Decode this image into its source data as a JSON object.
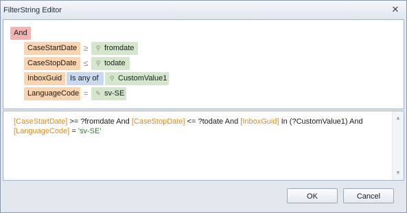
{
  "window": {
    "title": "FilterString Editor",
    "close_glyph": "✕"
  },
  "tree": {
    "group_operator": "And",
    "conditions": [
      {
        "field": "CaseStartDate",
        "operator": "≥",
        "value_icon": "parameter-icon",
        "value": "fromdate"
      },
      {
        "field": "CaseStopDate",
        "operator": "≤",
        "value_icon": "parameter-icon",
        "value": "todate"
      },
      {
        "field": "InboxGuid",
        "operator": "Is any of",
        "value_icon": "parameter-icon",
        "value": "CustomValue1"
      },
      {
        "field": "LanguageCode",
        "operator": "=",
        "value_icon": "pencil-icon",
        "value": "sv-SE"
      }
    ]
  },
  "filter_text": {
    "line1": [
      {
        "t": "[CaseStartDate]",
        "k": "field"
      },
      {
        "t": " >= ?fromdate And ",
        "k": "plain"
      },
      {
        "t": "[CaseStopDate]",
        "k": "field"
      },
      {
        "t": " <= ?todate And ",
        "k": "plain"
      },
      {
        "t": "[InboxGuid]",
        "k": "field"
      },
      {
        "t": " In (?CustomValue1) And",
        "k": "plain"
      }
    ],
    "line2": [
      {
        "t": "[LanguageCode]",
        "k": "field"
      },
      {
        "t": " = ",
        "k": "plain"
      },
      {
        "t": "'sv-SE'",
        "k": "value"
      }
    ]
  },
  "buttons": {
    "ok": "OK",
    "cancel": "Cancel"
  },
  "colors": {
    "group_chip": "#f4b4b2",
    "field_chip": "#fad4ae",
    "value_chip": "#d4e7cd",
    "operator_chip": "#c8d8ee",
    "field_text": "#d98a1c",
    "value_text": "#2e7d32"
  }
}
